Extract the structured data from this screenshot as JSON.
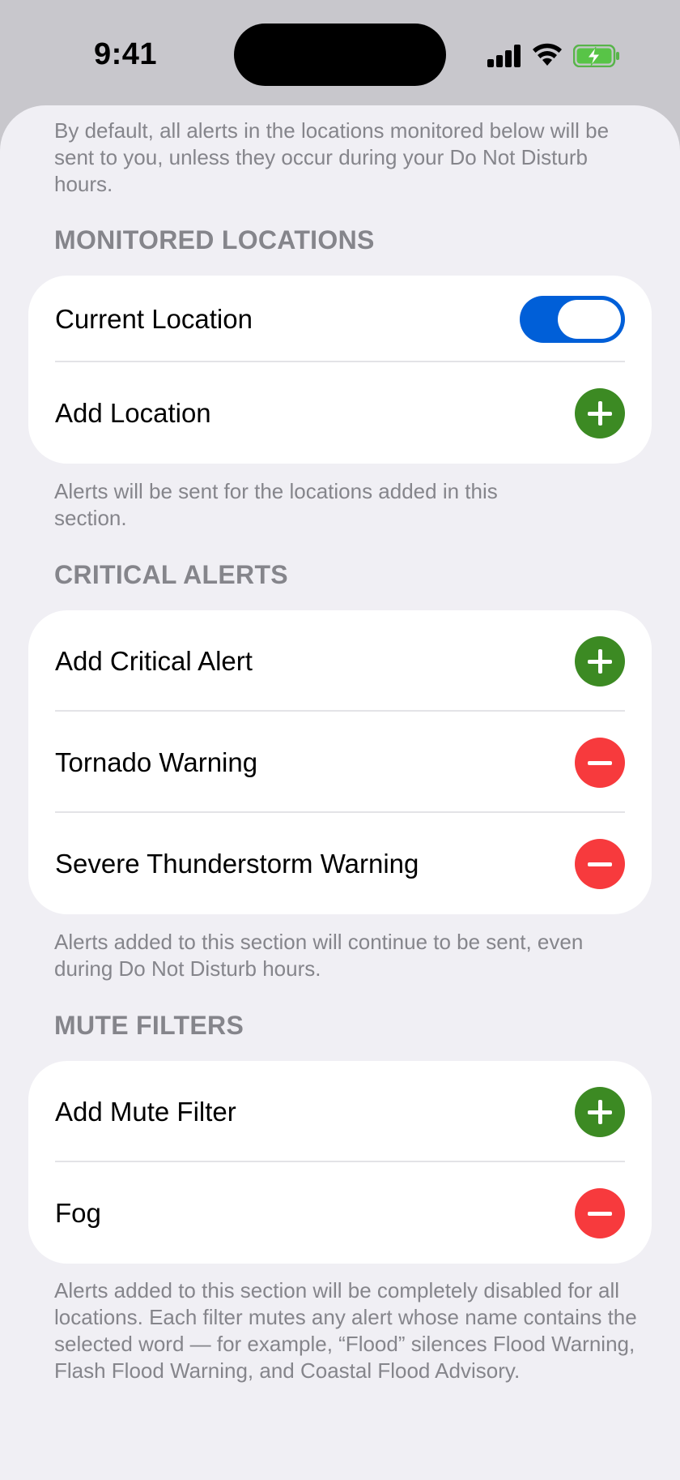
{
  "status_bar": {
    "time": "9:41"
  },
  "intro_text": "By default, all alerts in the locations monitored below will be sent to you, unless they occur during your Do Not Disturb hours.",
  "monitored_locations": {
    "header": "MONITORED LOCATIONS",
    "current_location": {
      "label": "Current Location",
      "toggle_on": true
    },
    "add_location": {
      "label": "Add Location"
    },
    "footer": "Alerts will be sent for the locations added in this section."
  },
  "critical_alerts": {
    "header": "CRITICAL ALERTS",
    "add_label": "Add Critical Alert",
    "items": [
      {
        "label": "Tornado Warning"
      },
      {
        "label": "Severe Thunderstorm Warning"
      }
    ],
    "footer": "Alerts added to this section will continue to be sent, even during Do Not Disturb hours."
  },
  "mute_filters": {
    "header": "MUTE FILTERS",
    "add_label": "Add Mute Filter",
    "items": [
      {
        "label": "Fog"
      }
    ],
    "footer": "Alerts added to this section will be completely disabled for all locations. Each filter mutes any alert whose name contains the selected word — for example, “Flood” silences Flood Warning, Flash Flood Warning, and Coastal Flood Advisory."
  },
  "colors": {
    "add_green": "#3c8a23",
    "remove_red": "#f73a3d",
    "toggle_blue": "#005fd8",
    "background": "#f0eff4"
  },
  "icons": [
    "signal-icon",
    "wifi-icon",
    "battery-charging-icon",
    "plus-icon",
    "minus-icon"
  ]
}
